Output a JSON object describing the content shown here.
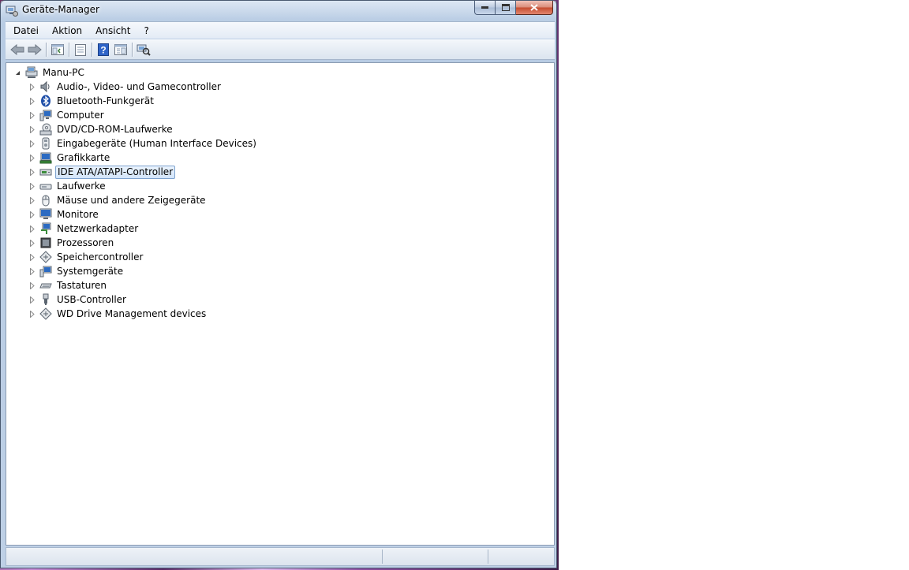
{
  "window": {
    "title": "Geräte-Manager",
    "controls": {
      "minimize": "minimize",
      "maximize": "maximize",
      "close": "close"
    }
  },
  "menu": [
    "Datei",
    "Aktion",
    "Ansicht",
    "?"
  ],
  "toolbar": [
    {
      "name": "back-icon"
    },
    {
      "name": "forward-icon"
    },
    {
      "name": "show-hide-console-tree-icon"
    },
    {
      "name": "properties-icon"
    },
    {
      "name": "help-icon"
    },
    {
      "name": "action-pane-icon"
    },
    {
      "name": "scan-hardware-icon"
    }
  ],
  "tree": {
    "root": "Manu-PC",
    "items": [
      {
        "label": "Audio-, Video- und Gamecontroller",
        "icon": "speaker-icon"
      },
      {
        "label": "Bluetooth-Funkgerät",
        "icon": "bluetooth-icon"
      },
      {
        "label": "Computer",
        "icon": "computer-icon"
      },
      {
        "label": "DVD/CD-ROM-Laufwerke",
        "icon": "dvd-drive-icon"
      },
      {
        "label": "Eingabegeräte (Human Interface Devices)",
        "icon": "hid-icon"
      },
      {
        "label": "Grafikkarte",
        "icon": "display-adapter-icon"
      },
      {
        "label": "IDE ATA/ATAPI-Controller",
        "icon": "ide-controller-icon",
        "selected": true
      },
      {
        "label": "Laufwerke",
        "icon": "disk-drive-icon"
      },
      {
        "label": "Mäuse und andere Zeigegeräte",
        "icon": "mouse-icon"
      },
      {
        "label": "Monitore",
        "icon": "monitor-icon"
      },
      {
        "label": "Netzwerkadapter",
        "icon": "network-adapter-icon"
      },
      {
        "label": "Prozessoren",
        "icon": "processor-icon"
      },
      {
        "label": "Speichercontroller",
        "icon": "storage-controller-icon"
      },
      {
        "label": "Systemgeräte",
        "icon": "system-devices-icon"
      },
      {
        "label": "Tastaturen",
        "icon": "keyboard-icon"
      },
      {
        "label": "USB-Controller",
        "icon": "usb-icon"
      },
      {
        "label": "WD Drive Management devices",
        "icon": "wd-device-icon"
      }
    ]
  },
  "colors": {
    "selection_border": "#7da2ce",
    "selection_fill": "#d3e5fa",
    "window_frame": "#b7cbe3"
  }
}
